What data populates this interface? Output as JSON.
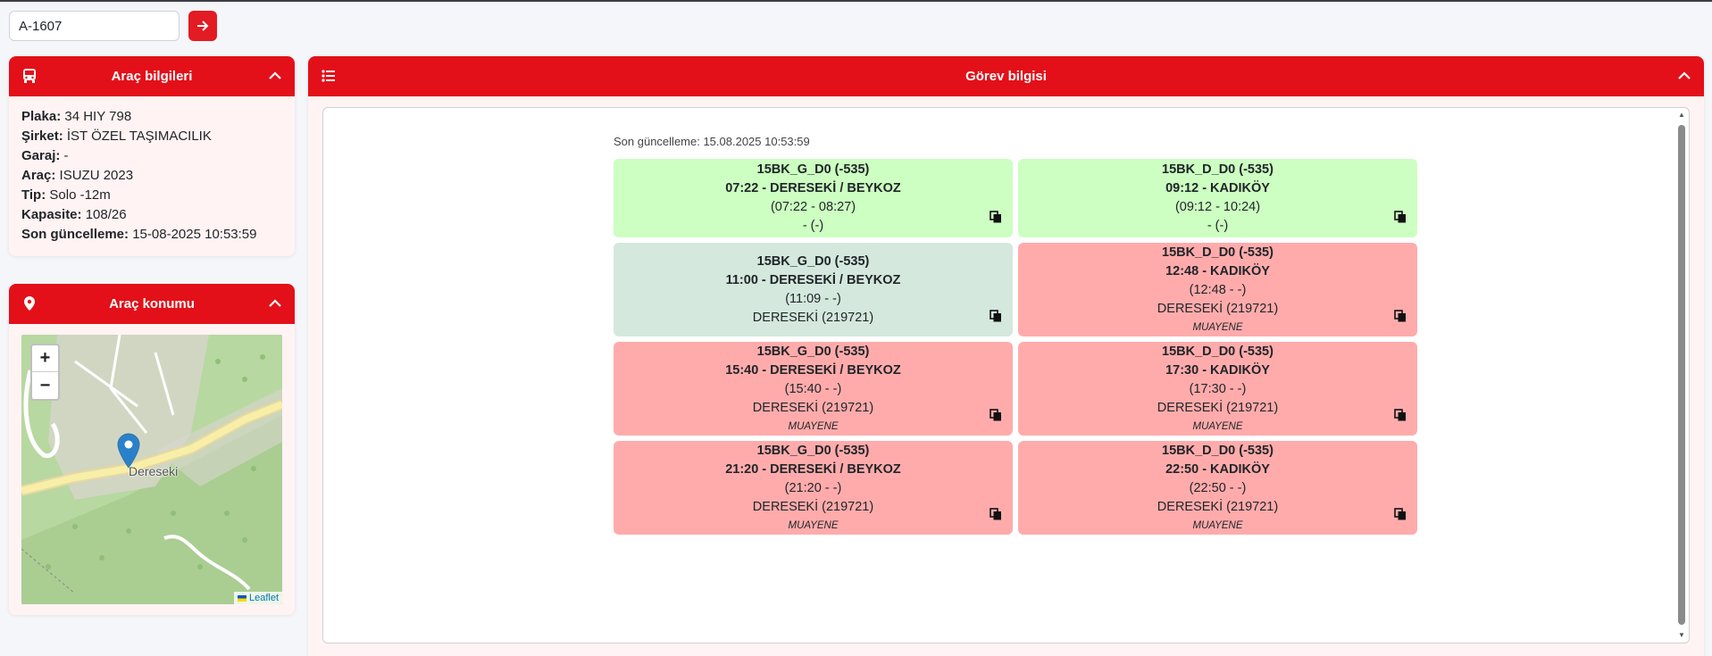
{
  "search": {
    "value": "A-1607"
  },
  "vehicle": {
    "title": "Araç bilgileri",
    "fields": [
      {
        "label": "Plaka:",
        "value": "34 HIY 798"
      },
      {
        "label": "Şirket:",
        "value": "İST ÖZEL TAŞIMACILIK"
      },
      {
        "label": "Garaj:",
        "value": "-"
      },
      {
        "label": "Araç:",
        "value": "ISUZU 2023"
      },
      {
        "label": "Tip:",
        "value": "Solo -12m"
      },
      {
        "label": "Kapasite:",
        "value": "108/26"
      },
      {
        "label": "Son güncelleme:",
        "value": "15-08-2025 10:53:59"
      }
    ]
  },
  "location": {
    "title": "Araç konumu",
    "marker_label": "Dereseki",
    "zoom_in": "+",
    "zoom_out": "−",
    "attribution": "Leaflet"
  },
  "task": {
    "title": "Görev bilgisi",
    "last_update": "Son güncelleme: 15.08.2025 10:53:59",
    "duties": [
      {
        "code": "15BK_G_D0 (-535)",
        "route": "07:22 - DERESEKİ / BEYKOZ",
        "time": "(07:22 - 08:27)",
        "place": "- (-)",
        "note": "",
        "status": "green"
      },
      {
        "code": "15BK_D_D0 (-535)",
        "route": "09:12 - KADIKÖY",
        "time": "(09:12 - 10:24)",
        "place": "- (-)",
        "note": "",
        "status": "green"
      },
      {
        "code": "15BK_G_D0 (-535)",
        "route": "11:00 - DERESEKİ / BEYKOZ",
        "time": "(11:09 - -)",
        "place": "DERESEKİ (219721)",
        "note": "",
        "status": "teal"
      },
      {
        "code": "15BK_D_D0 (-535)",
        "route": "12:48 - KADIKÖY",
        "time": "(12:48 - -)",
        "place": "DERESEKİ (219721)",
        "note": "MUAYENE",
        "status": "red"
      },
      {
        "code": "15BK_G_D0 (-535)",
        "route": "15:40 - DERESEKİ / BEYKOZ",
        "time": "(15:40 - -)",
        "place": "DERESEKİ (219721)",
        "note": "MUAYENE",
        "status": "red"
      },
      {
        "code": "15BK_D_D0 (-535)",
        "route": "17:30 - KADIKÖY",
        "time": "(17:30 - -)",
        "place": "DERESEKİ (219721)",
        "note": "MUAYENE",
        "status": "red"
      },
      {
        "code": "15BK_G_D0 (-535)",
        "route": "21:20 - DERESEKİ / BEYKOZ",
        "time": "(21:20 - -)",
        "place": "DERESEKİ (219721)",
        "note": "MUAYENE",
        "status": "red"
      },
      {
        "code": "15BK_D_D0 (-535)",
        "route": "22:50 - KADIKÖY",
        "time": "(22:50 - -)",
        "place": "DERESEKİ (219721)",
        "note": "MUAYENE",
        "status": "red"
      }
    ]
  },
  "colors": {
    "accent": "#e31019",
    "green": "#ccffc1",
    "teal": "#d4e8dd",
    "red": "#ffabab"
  },
  "icons": {
    "go": "arrow-right-icon",
    "vehicle": "bus-icon",
    "location": "map-pin-icon",
    "task": "list-icon",
    "collapse": "chevron-up-icon",
    "copy": "copy-icon"
  }
}
